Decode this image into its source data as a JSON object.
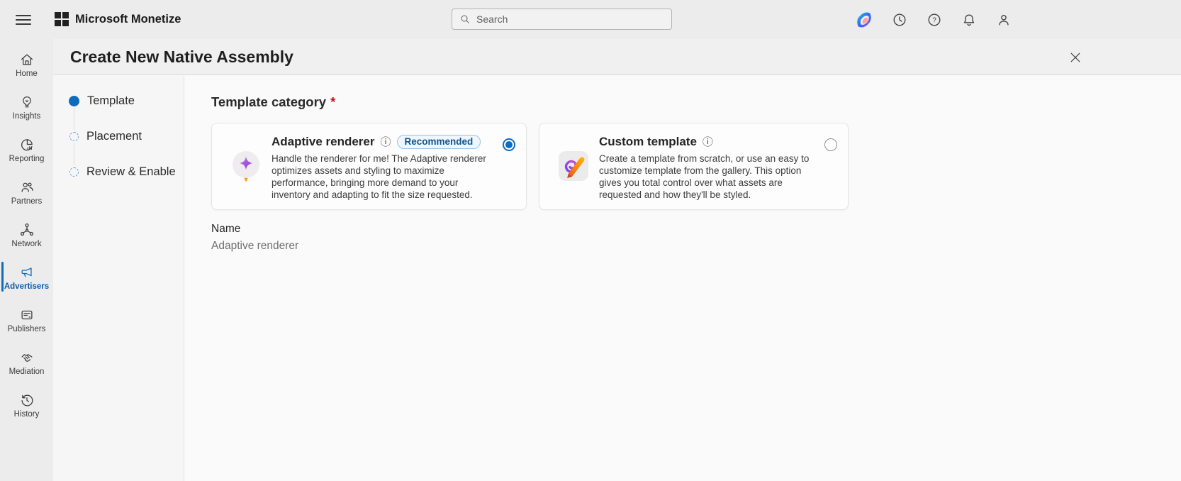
{
  "topbar": {
    "app_name": "Microsoft Monetize",
    "search": {
      "placeholder": "Search"
    },
    "icon_names": [
      "menu-icon",
      "microsoft-logo-icon",
      "copilot-icon",
      "history-clock-icon",
      "help-icon",
      "notifications-icon",
      "account-icon"
    ]
  },
  "sidebar": {
    "items": [
      {
        "label": "Home",
        "icon": "home-icon",
        "active": false
      },
      {
        "label": "Insights",
        "icon": "insights-icon",
        "active": false
      },
      {
        "label": "Reporting",
        "icon": "reporting-icon",
        "active": false
      },
      {
        "label": "Partners",
        "icon": "partners-icon",
        "active": false
      },
      {
        "label": "Network",
        "icon": "network-icon",
        "active": false
      },
      {
        "label": "Advertisers",
        "icon": "advertisers-icon",
        "active": true
      },
      {
        "label": "Publishers",
        "icon": "publishers-icon",
        "active": false
      },
      {
        "label": "Mediation",
        "icon": "mediation-icon",
        "active": false
      },
      {
        "label": "History",
        "icon": "history-icon",
        "active": false
      }
    ]
  },
  "dialog": {
    "title": "Create New Native Assembly",
    "close_icon": "close-icon",
    "steps": [
      {
        "label": "Template",
        "state": "current"
      },
      {
        "label": "Placement",
        "state": "upcoming"
      },
      {
        "label": "Review & Enable",
        "state": "upcoming"
      }
    ],
    "template_category": {
      "heading": "Template category",
      "required_marker": "*",
      "options": [
        {
          "title": "Adaptive renderer",
          "badge": "Recommended",
          "selected": true,
          "icon": "sparkle-icon",
          "description": "Handle the renderer for me! The Adaptive renderer optimizes assets and styling to maximize performance, bringing more demand to your inventory and adapting to fit the size requested."
        },
        {
          "title": "Custom template",
          "selected": false,
          "icon": "pen-icon",
          "description": "Create a template from scratch, or use an easy to customize template from the gallery. This option gives you total control over what assets are requested and how they'll be styled."
        }
      ],
      "name_field": {
        "label": "Name",
        "value": "Adaptive renderer"
      }
    }
  },
  "icons": {
    "info_glyph": "ⓘ",
    "question_glyph": "?"
  },
  "colors": {
    "accent": "#0f6cbd",
    "required_asterisk": "#c50f1f",
    "badge_bg": "#f0f6fe",
    "badge_border": "#9cc0e8",
    "badge_text": "#0f548c",
    "chrome_gray": "#ececec"
  }
}
